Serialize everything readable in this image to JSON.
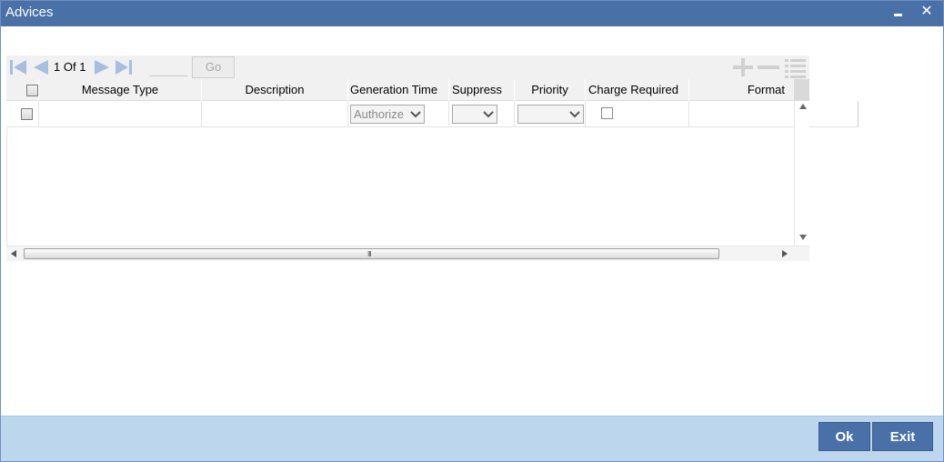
{
  "window": {
    "title": "Advices",
    "minimize_icon": "minimize-icon",
    "close_symbol": "✕"
  },
  "pager": {
    "current_page": "1",
    "of_label": "Of",
    "total_pages": "1",
    "page_input_value": "",
    "go_label": "Go"
  },
  "toolbar_icons": [
    "plus-icon",
    "minus-icon",
    "list-icon"
  ],
  "table": {
    "columns": [
      "Message Type",
      "Description",
      "Generation Time",
      "Suppress",
      "Priority",
      "Charge Required",
      "Format"
    ],
    "rows": [
      {
        "message_type": "",
        "description": "",
        "generation_time": "Authorize",
        "suppress": "",
        "priority": "",
        "charge_required": false,
        "format": ""
      }
    ]
  },
  "scrollbar": {
    "grip": "III"
  },
  "footer": {
    "ok_label": "Ok",
    "exit_label": "Exit"
  },
  "colors": {
    "title_bar": "#4a70a8",
    "footer_bg": "#bcd6ee",
    "button_bg": "#4a70a8",
    "nav_icon": "#a6bfe0"
  }
}
